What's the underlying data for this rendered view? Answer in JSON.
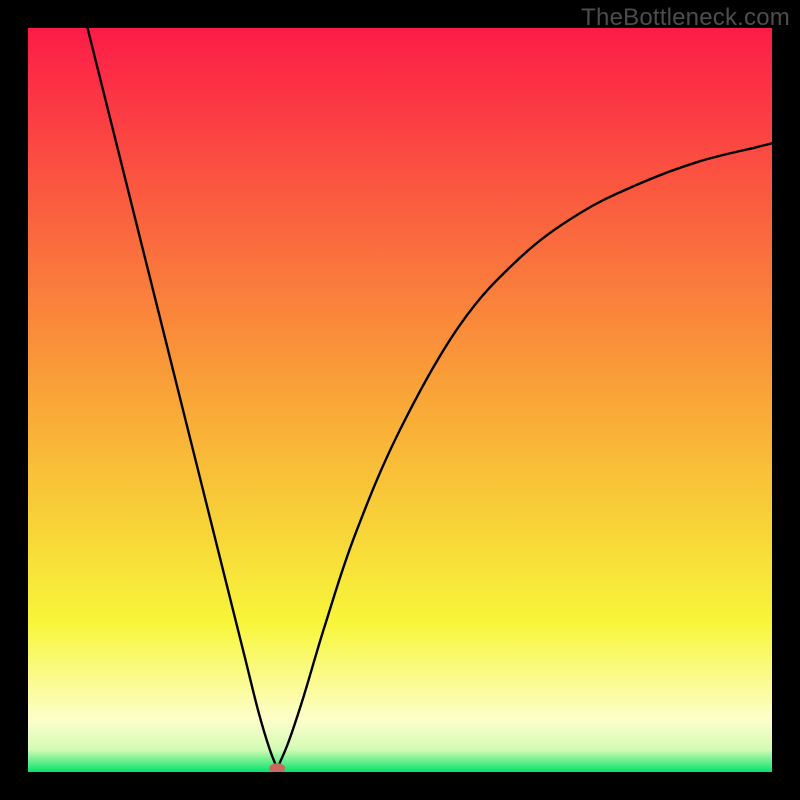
{
  "watermark": "TheBottleneck.com",
  "chart_data": {
    "type": "line",
    "title": "",
    "xlabel": "",
    "ylabel": "",
    "xlim": [
      0,
      100
    ],
    "ylim": [
      0,
      100
    ],
    "legend": false,
    "grid": false,
    "background_gradient": {
      "stops": [
        {
          "offset": 0.0,
          "color": "#fc1c47"
        },
        {
          "offset": 0.5,
          "color": "#f9a637"
        },
        {
          "offset": 0.8,
          "color": "#f8f63a"
        },
        {
          "offset": 0.93,
          "color": "#fdfecb"
        },
        {
          "offset": 0.97,
          "color": "#d3fbb4"
        },
        {
          "offset": 1.0,
          "color": "#04e36b"
        }
      ]
    },
    "series": [
      {
        "name": "left-branch",
        "x": [
          8,
          10,
          14,
          18,
          22,
          26,
          29,
          31,
          32.5,
          33.5
        ],
        "y": [
          100,
          92,
          76,
          60,
          44,
          28,
          16,
          8,
          3,
          0.5
        ]
      },
      {
        "name": "right-branch",
        "x": [
          33.5,
          35,
          37,
          40,
          44,
          50,
          58,
          66,
          74,
          82,
          90,
          98,
          100
        ],
        "y": [
          0.5,
          4,
          10,
          20,
          32,
          46,
          60,
          69,
          75,
          79,
          82,
          84,
          84.5
        ]
      }
    ],
    "marker": {
      "name": "dip-marker",
      "x": 33.5,
      "y": 0.5,
      "color": "#c76a60"
    }
  }
}
